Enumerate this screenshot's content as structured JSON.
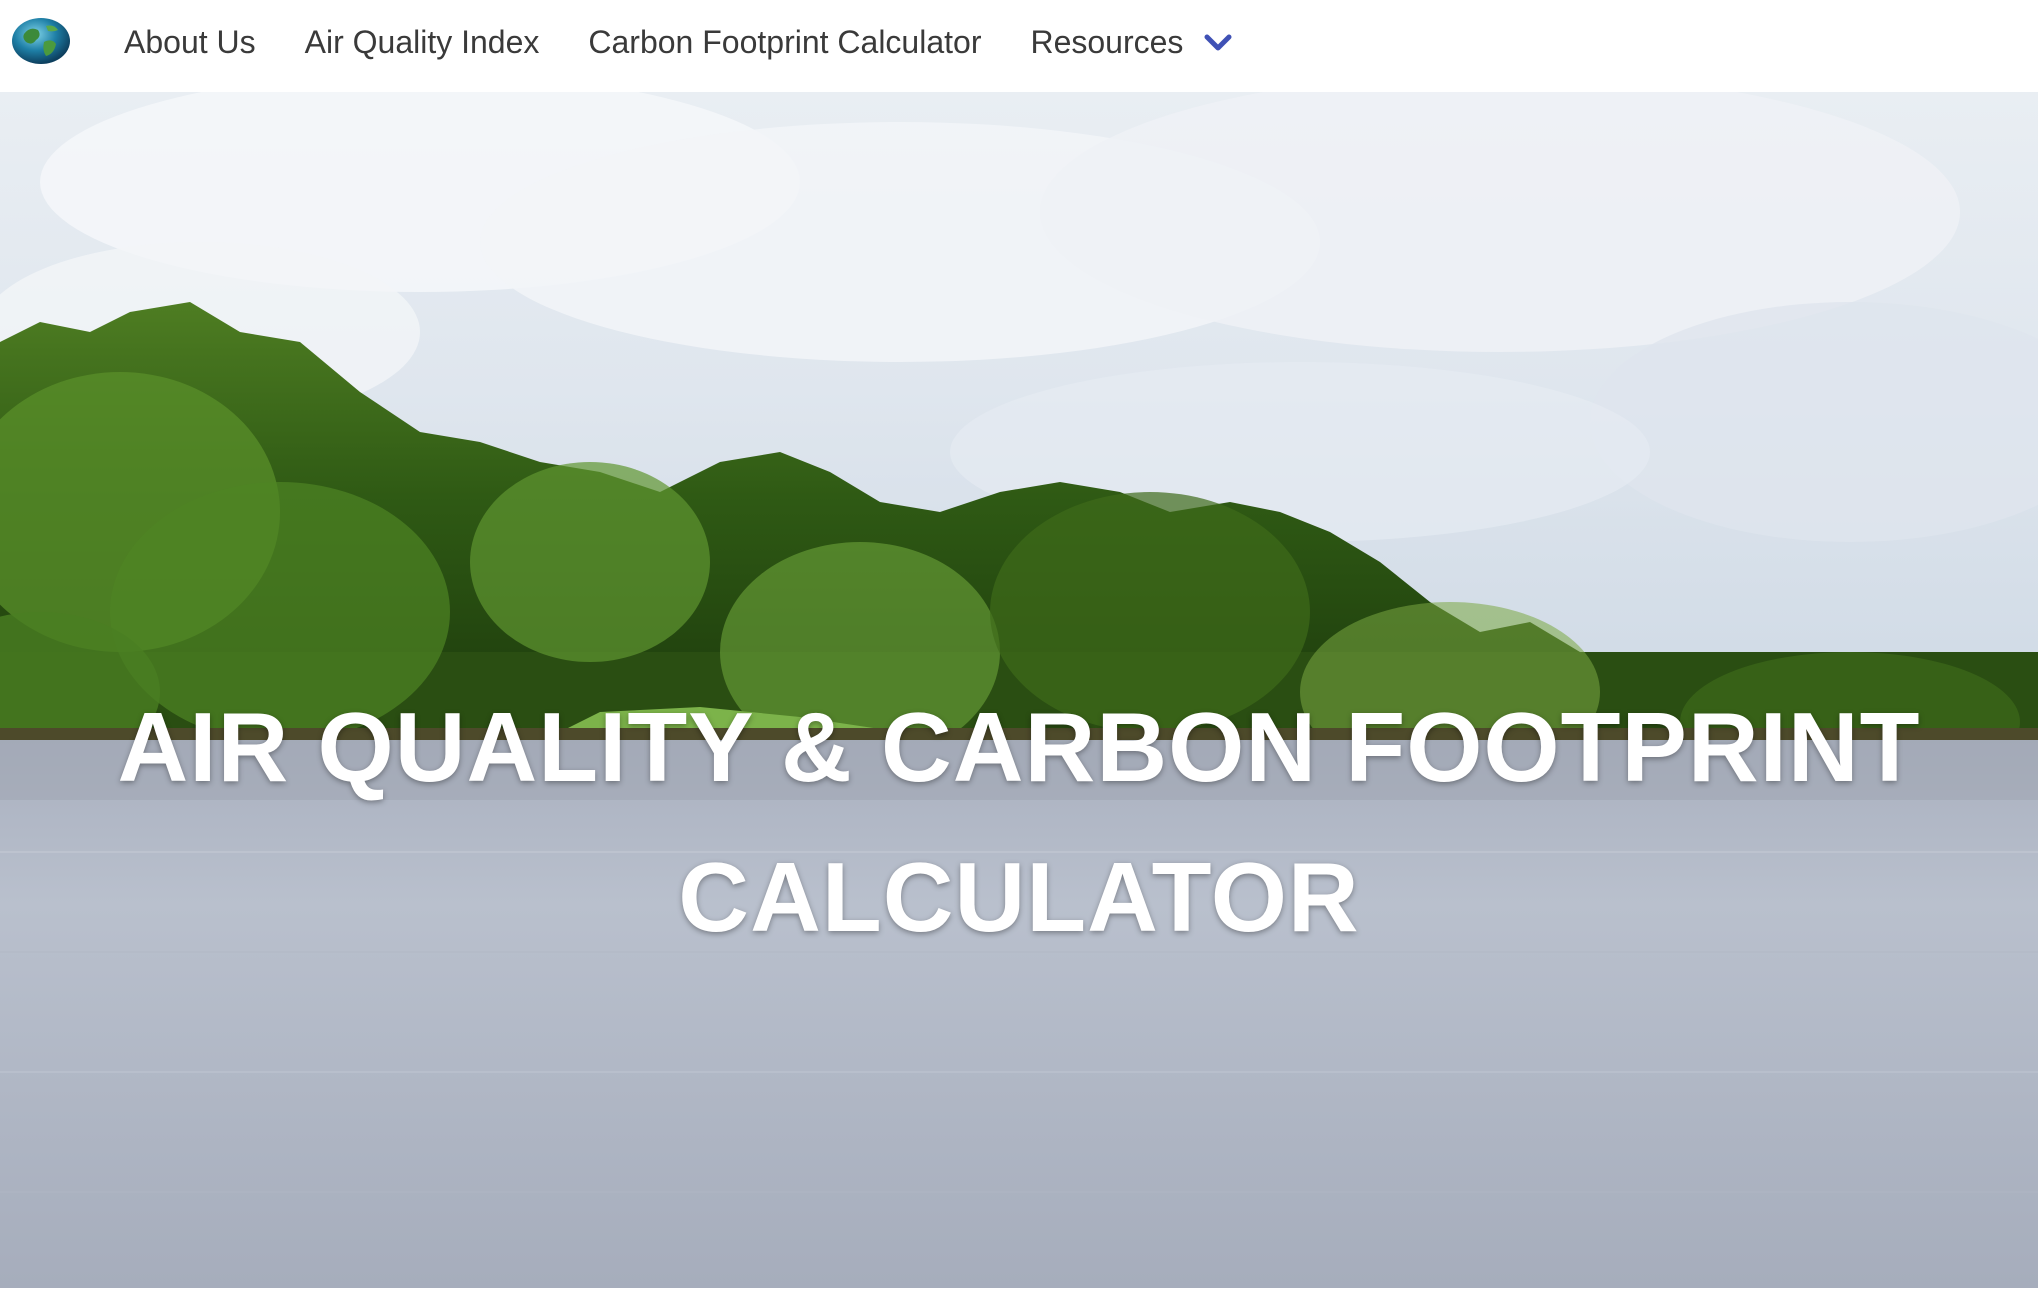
{
  "nav": {
    "logo_icon": "globe-icon",
    "items": [
      {
        "label": "About Us"
      },
      {
        "label": "Air Quality Index"
      },
      {
        "label": "Carbon Footprint Calculator"
      },
      {
        "label": "Resources",
        "icon": "chevron-down-icon"
      }
    ]
  },
  "hero": {
    "title_line1": "AIR QUALITY & CARBON FOOTPRINT",
    "title_line2": "CALCULATOR",
    "background": "river-forest-landscape-photo"
  },
  "colors": {
    "nav_text": "#3a3a3a",
    "accent": "#3f51b5",
    "hero_text": "#ffffff"
  }
}
